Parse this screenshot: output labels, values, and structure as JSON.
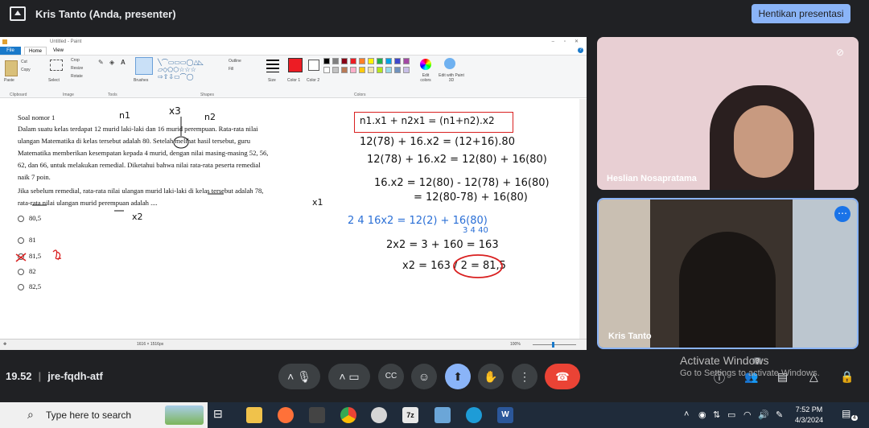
{
  "topbar": {
    "title": "Kris Tanto (Anda, presenter)",
    "stop_button": "Hentikan presentasi"
  },
  "paint": {
    "window_title": "Untitled - Paint",
    "menu": {
      "file": "File",
      "home": "Home",
      "view": "View"
    },
    "ribbon": {
      "cut": "Cut",
      "copy": "Copy",
      "paste": "Paste",
      "select": "Select",
      "crop": "Crop",
      "resize": "Resize",
      "rotate": "Rotate",
      "brushes": "Brushes",
      "outline": "Outline",
      "fill": "Fill",
      "size": "Size",
      "color1": "Color 1",
      "color2": "Color 2",
      "edit_colors": "Edit colors",
      "edit_paint3d": "Edit with Paint 3D",
      "groups": [
        "Clipboard",
        "Image",
        "Tools",
        "Shapes",
        "Colors"
      ]
    },
    "palette": [
      "#000000",
      "#7f7f7f",
      "#880015",
      "#ed1c24",
      "#ff7f27",
      "#fff200",
      "#22b14c",
      "#00a2e8",
      "#3f48cc",
      "#a349a4",
      "#ffffff",
      "#c3c3c3",
      "#b97a57",
      "#ffaec9",
      "#ffc90e",
      "#efe4b0",
      "#b5e61d",
      "#99d9ea",
      "#7092be",
      "#c8bfe7"
    ],
    "status": {
      "dimensions": "1616 × 1516px",
      "zoom": "100%"
    }
  },
  "question": {
    "lines": [
      "Soal nomor 1",
      "Dalam suatu kelas terdapat 12 murid laki-laki dan 16 murid perempuan. Rata-rata nilai",
      "ulangan Matematika di kelas tersebut adalah 80. Setelah melihat hasil tersebut, guru",
      "Matematika memberikan kesempatan kepada 4 murid, dengan nilai masing-masing 52, 56,",
      "62, dan 66, untuk melakukan remedial. Diketahui bahwa nilai rata-rata peserta remedial",
      "naik 7 poin.",
      "Jika sebelum remedial, rata-rata nilai ulangan murid laki-laki di kelas tersebut adalah 78,",
      "rata-rata nilai ulangan murid perempuan adalah ...."
    ],
    "options": [
      "80,5",
      "81",
      "81,5",
      "82",
      "82,5"
    ]
  },
  "handwriting": {
    "n1": "n1",
    "x3": "x3",
    "n2": "n2",
    "x1": "x1",
    "x2": "x2",
    "formula": "n1.x1 + n2x1 = (n1+n2).x2",
    "l1": "12(78) + 16.x2 = (12+16).80",
    "l2": "12(78) + 16.x2 = 12(80) + 16(80)",
    "l3": "16.x2 = 12(80) - 12(78) + 16(80)",
    "l4": "= 12(80-78) + 16(80)",
    "l5": "2 4 16x2 = 12(2) + 16(80)",
    "l5b": "3     4  40",
    "l6": "2x2 = 3 + 160 = 163",
    "l7": "x2 = 163 / 2 = 81,5"
  },
  "participants": [
    {
      "name": "Heslian Nosapratama",
      "muted": true
    },
    {
      "name": "Kris Tanto"
    }
  ],
  "meeting": {
    "time": "19.52",
    "code": "jre-fqdh-atf"
  },
  "watermark": {
    "line1": "Activate Windows",
    "line2": "Go to Settings to activate Windows.",
    "badge": "3"
  },
  "taskbar": {
    "search_placeholder": "Type here to search",
    "time": "7:52 PM",
    "date": "4/3/2024",
    "notif_count": "4"
  }
}
